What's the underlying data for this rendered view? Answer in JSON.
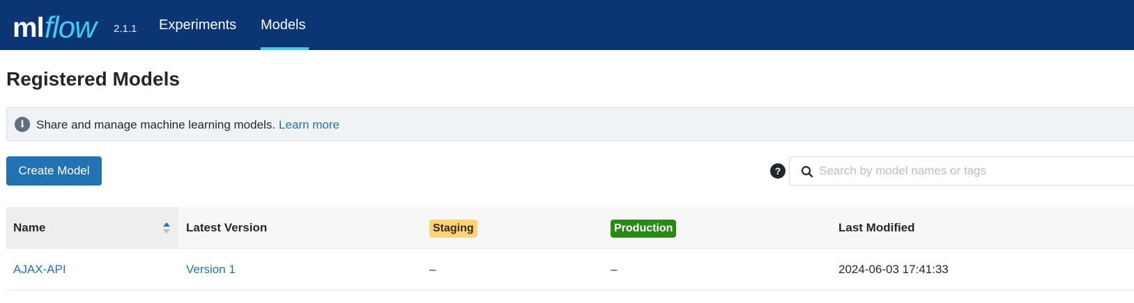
{
  "header": {
    "logo_ml": "ml",
    "logo_flow": "flow",
    "version": "2.1.1",
    "nav": [
      {
        "label": "Experiments",
        "active": false
      },
      {
        "label": "Models",
        "active": true
      }
    ],
    "background_color": "#0b3574",
    "accent_color": "#43c9ed"
  },
  "page": {
    "title": "Registered Models"
  },
  "info_banner": {
    "icon": "info-icon",
    "text": "Share and manage machine learning models.",
    "link_text": "Learn more"
  },
  "toolbar": {
    "create_button_label": "Create Model",
    "help_icon_glyph": "?",
    "search_placeholder": "Search by model names or tags",
    "search_value": ""
  },
  "table": {
    "columns": {
      "name": "Name",
      "latest_version": "Latest Version",
      "staging": "Staging",
      "production": "Production",
      "last_modified": "Last Modified"
    },
    "sort": {
      "column": "name",
      "direction": "ascending"
    },
    "rows": [
      {
        "name": "AJAX-API",
        "latest_version": "Version 1",
        "staging": "–",
        "production": "–",
        "last_modified": "2024-06-03 17:41:33"
      }
    ]
  },
  "colors": {
    "link": "#2272b4",
    "primary_button": "#2272b4",
    "staging_badge": "#fad37a",
    "production_badge": "#288a14"
  }
}
